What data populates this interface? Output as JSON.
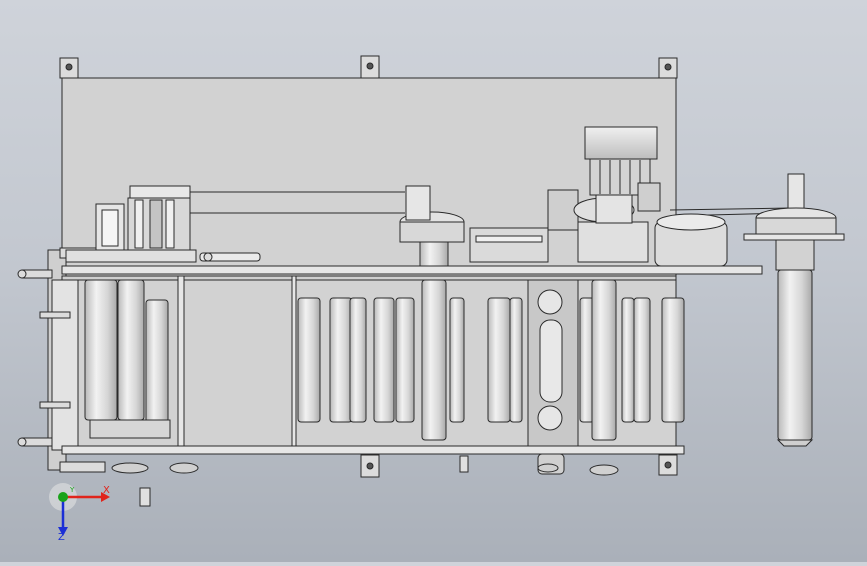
{
  "view": {
    "background_top": "#cfd3da",
    "background_bottom": "#aab0b9",
    "part_fill": "#dcdcdc",
    "part_shade": "#c9c9c9",
    "edge_color": "#2a2a2a"
  },
  "axis_triad": {
    "x_label": "X",
    "y_label": "Y",
    "z_label": "Z",
    "x_color": "#e0241b",
    "y_color": "#1aa31a",
    "z_color": "#1b2fd6"
  }
}
